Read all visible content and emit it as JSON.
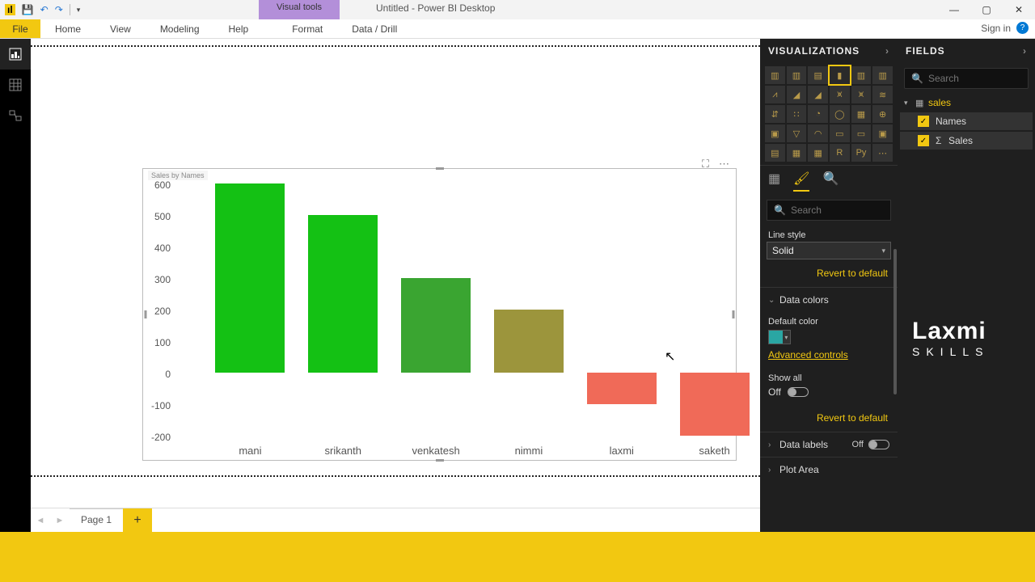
{
  "window": {
    "contextual_tab": "Visual tools",
    "title": "Untitled - Power BI Desktop",
    "signin": "Sign in"
  },
  "menu": {
    "file": "File",
    "tabs": [
      "Home",
      "View",
      "Modeling",
      "Help",
      "Format",
      "Data / Drill"
    ]
  },
  "page": {
    "name": "Page 1"
  },
  "visual_panel": {
    "header": "VISUALIZATIONS",
    "search_placeholder": "Search",
    "format": {
      "line_style_label": "Line style",
      "line_style_value": "Solid",
      "revert": "Revert to default",
      "data_colors_label": "Data colors",
      "default_color_label": "Default color",
      "advanced_controls": "Advanced controls",
      "show_all_label": "Show all",
      "show_all_value": "Off",
      "data_labels_label": "Data labels",
      "data_labels_value": "Off",
      "plot_area_label": "Plot Area"
    }
  },
  "fields_panel": {
    "header": "FIELDS",
    "search_placeholder": "Search",
    "table": "sales",
    "fields": [
      {
        "name": "Names",
        "checked": true,
        "agg": false
      },
      {
        "name": "Sales",
        "checked": true,
        "agg": true
      }
    ]
  },
  "brand": {
    "line1": "Laxmi",
    "line2": "SKILLS"
  },
  "chart_data": {
    "type": "bar",
    "title": "Sales by Names",
    "xlabel": "",
    "ylabel": "",
    "ylim": [
      -200,
      600
    ],
    "yticks": [
      600,
      500,
      400,
      300,
      200,
      100,
      0,
      -100,
      -200
    ],
    "categories": [
      "mani",
      "srikanth",
      "venkatesh",
      "nimmi",
      "laxmi",
      "saketh"
    ],
    "values": [
      600,
      500,
      300,
      200,
      -100,
      -200
    ],
    "colors": [
      "#14c114",
      "#14c114",
      "#3aa531",
      "#9c953c",
      "#f06a58",
      "#f06a58"
    ]
  }
}
